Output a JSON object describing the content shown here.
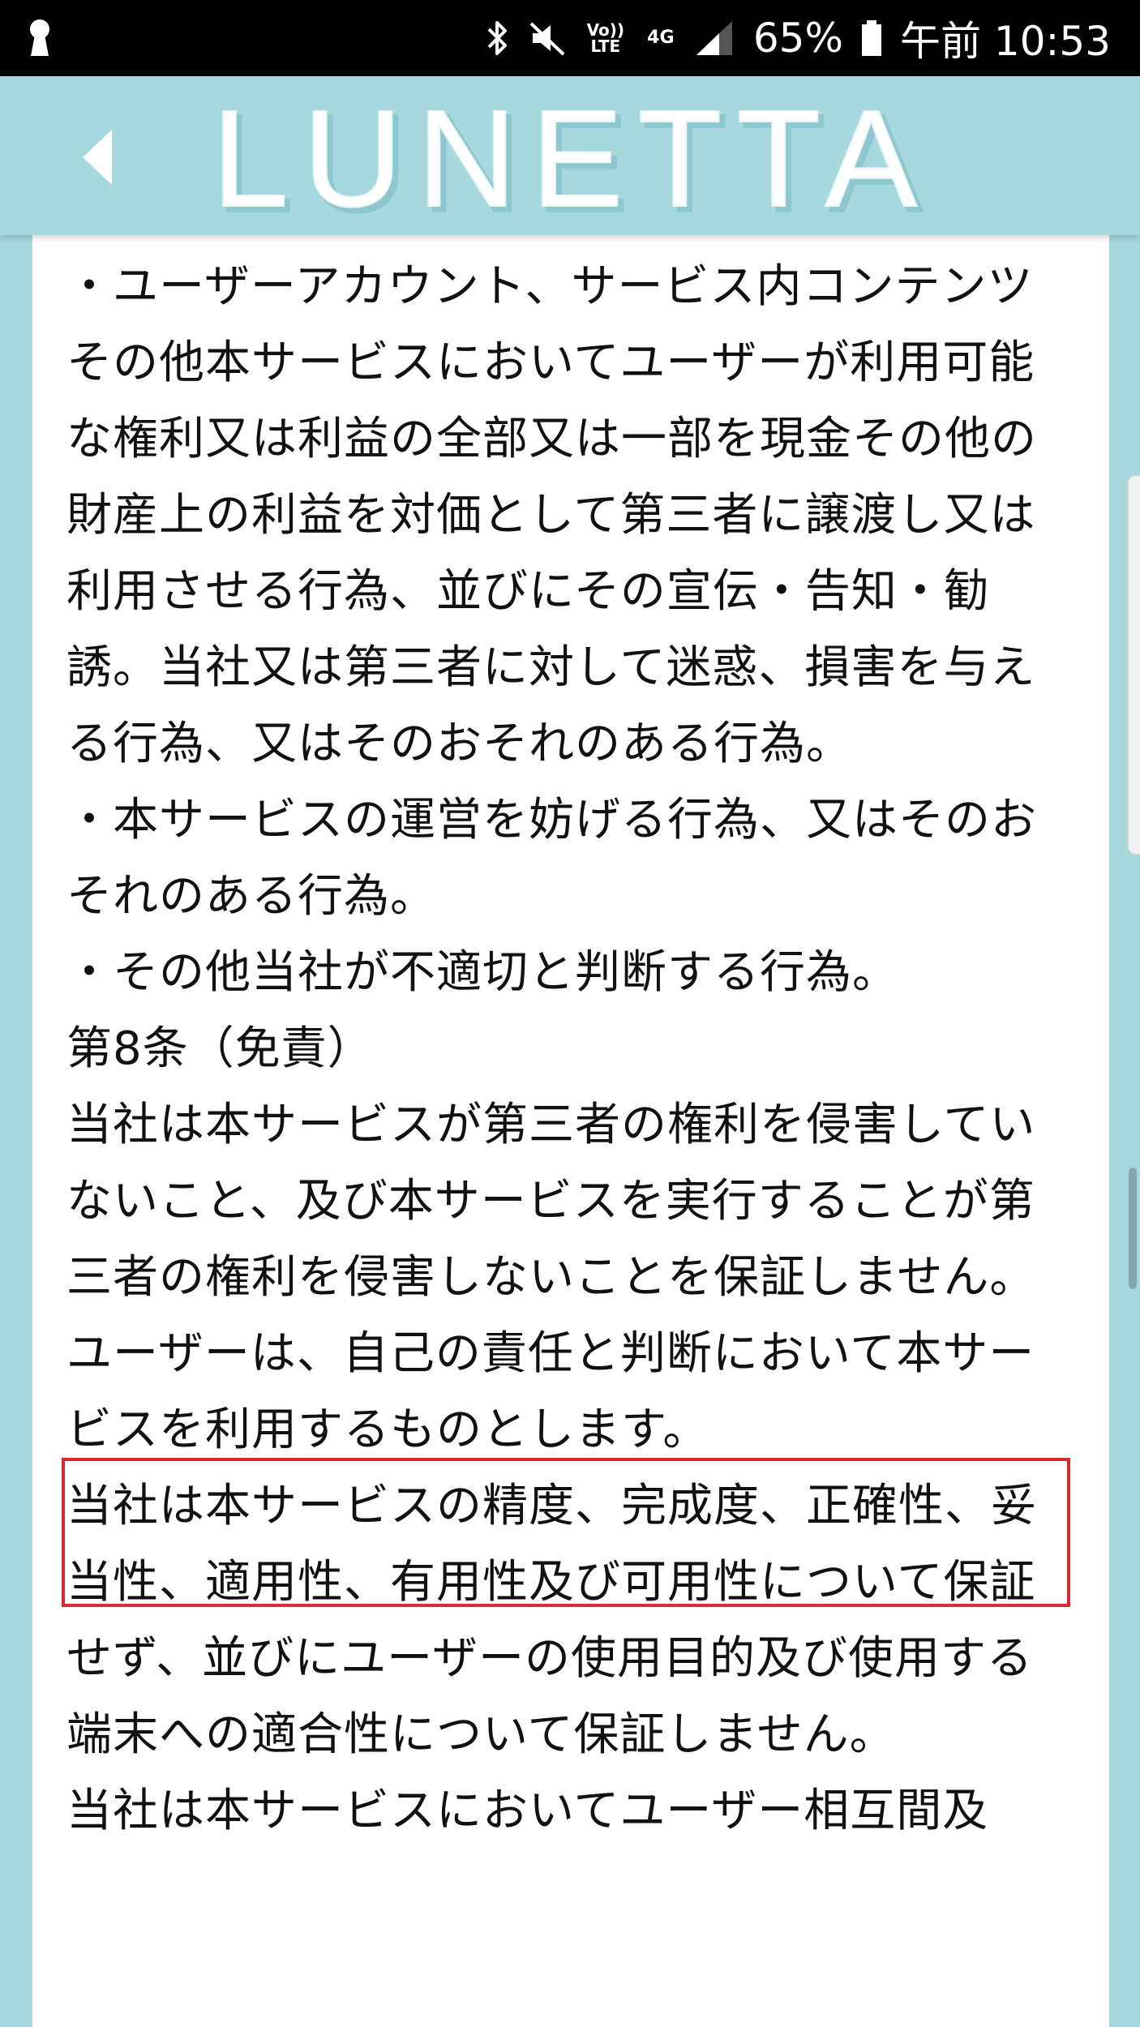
{
  "status_bar": {
    "network_volte_label": "Vo)) LTE",
    "network_type_label": "4G",
    "battery_percent": "65%",
    "time": "午前 10:53"
  },
  "header": {
    "title": "LUNETTA",
    "back_icon": "chevron-left-icon"
  },
  "content": {
    "paragraphs": [
      "・ユーザーアカウント、サービス内コンテンツその他本サービスにおいてユーザーが利用可能な権利又は利益の全部又は一部を現金その他の財産上の利益を対価として第三者に譲渡し又は利用させる行為、並びにその宣伝・告知・勧誘。当社又は第三者に対して迷惑、損害を与える行為、又はそのおそれのある行為。",
      "・本サービスの運営を妨げる行為、又はそのおそれのある行為。",
      "・その他当社が不適切と判断する行為。",
      "第8条（免責）",
      "当社は本サービスが第三者の権利を侵害していないこと、及び本サービスを実行することが第三者の権利を侵害しないことを保証しません。",
      "ユーザーは、自己の責任と判断において本サービスを利用するものとします。",
      "当社は本サービスの精度、完成度、正確性、妥当性、適用性、有用性及び可用性について保証せず、並びにユーザーの使用目的及び使用する端末への適合性について保証しません。",
      "当社は本サービスにおいてユーザー相互間及"
    ]
  },
  "colors": {
    "header_bg": "#a6d8de",
    "highlight_border": "#d72a33"
  }
}
